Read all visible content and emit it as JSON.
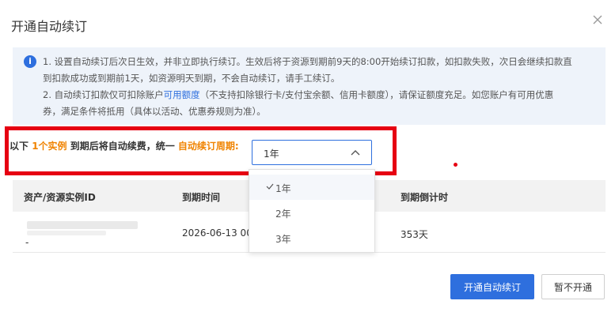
{
  "dialog": {
    "title": "开通自动续订",
    "close_icon": "close-icon"
  },
  "notice": {
    "icon": "info-icon",
    "line1": "1. 设置自动续订后次日生效，并非立即执行续订。生效后将于资源到期前9天的8:00开始续订扣款，如扣款失败，次日会继续扣款直",
    "line2": "到扣款成功或到期前1天，如资源明天到期，不会自动续订，请手工续订。",
    "line3_pre": "2. 自动续订扣款仅可扣除账户",
    "line3_link": "可用额度",
    "line3_post": "（不支持扣除银行卡/支付宝余额、信用卡额度），请保证额度充足。如您账户有可用优惠",
    "line4": "券，满足条件将抵用（具体以活动、优惠券规则为准）。"
  },
  "period": {
    "prefix": "以下 ",
    "count": "1个实例",
    "middle": " 到期后将自动续费，统一 ",
    "label": "自动续订周期:",
    "selected": "1年",
    "options": [
      "1年",
      "2年",
      "3年"
    ]
  },
  "table": {
    "headers": [
      "资产/资源实例ID",
      "到期时间",
      "到期倒计时"
    ],
    "rows": [
      {
        "id_sub": "-",
        "expire": "2026-06-13 00:00",
        "countdown": "353天"
      }
    ]
  },
  "footer": {
    "confirm": "开通自动续订",
    "cancel": "暂不开通"
  },
  "colors": {
    "primary": "#2e6fde",
    "accent": "#f08300",
    "highlight": "#e60012"
  }
}
